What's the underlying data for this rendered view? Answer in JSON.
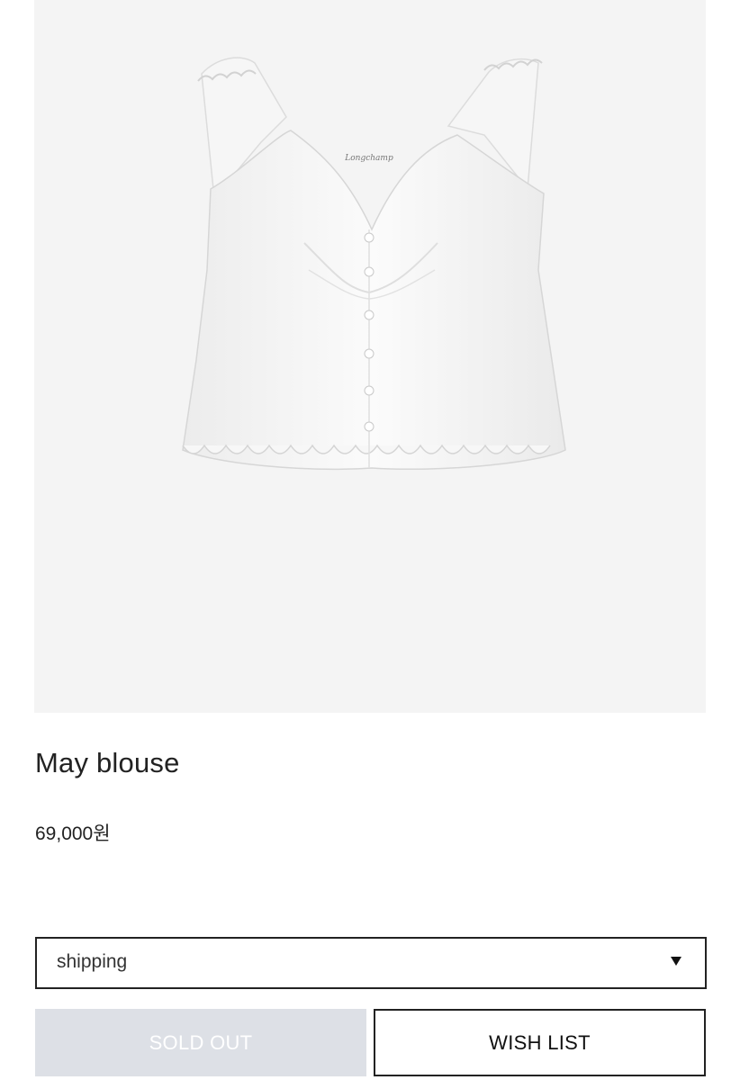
{
  "product": {
    "image_alt": "May blouse",
    "label_logo": "Longchamp",
    "title": "May blouse",
    "price": "69,000원"
  },
  "option_select": {
    "value": "shipping"
  },
  "buttons": {
    "sold_out": "SOLD OUT",
    "wish_list": "WISH LIST"
  },
  "colors": {
    "image_background": "#f4f4f4",
    "sold_out_bg": "#dde0e6",
    "border": "#222222"
  }
}
